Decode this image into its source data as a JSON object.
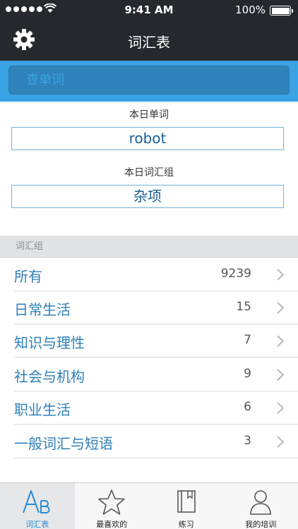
{
  "status_bar": {
    "time": "9:41 AM",
    "battery": "100%"
  },
  "nav": {
    "title": "词汇表"
  },
  "search": {
    "placeholder": "查单词"
  },
  "today": {
    "word_label": "本日单词",
    "word": "robot",
    "group_label": "本日词汇组",
    "group": "杂项"
  },
  "groups": {
    "header": "词汇组",
    "items": [
      {
        "label": "所有",
        "count": "9239"
      },
      {
        "label": "日常生活",
        "count": "15"
      },
      {
        "label": "知识与理性",
        "count": "7"
      },
      {
        "label": "社会与机构",
        "count": "9"
      },
      {
        "label": "职业生活",
        "count": "6"
      },
      {
        "label": "一般词汇与短语",
        "count": "3"
      }
    ]
  },
  "tabs": [
    {
      "label": "词汇表",
      "icon": "ab-letters-icon",
      "active": true
    },
    {
      "label": "最喜欢的",
      "icon": "star-icon",
      "active": false
    },
    {
      "label": "练习",
      "icon": "book-icon",
      "active": false
    },
    {
      "label": "我的培训",
      "icon": "person-icon",
      "active": false
    }
  ],
  "colors": {
    "accent": "#3aa3e3",
    "nav_bg": "#25282c",
    "link": "#2d7fb9"
  }
}
